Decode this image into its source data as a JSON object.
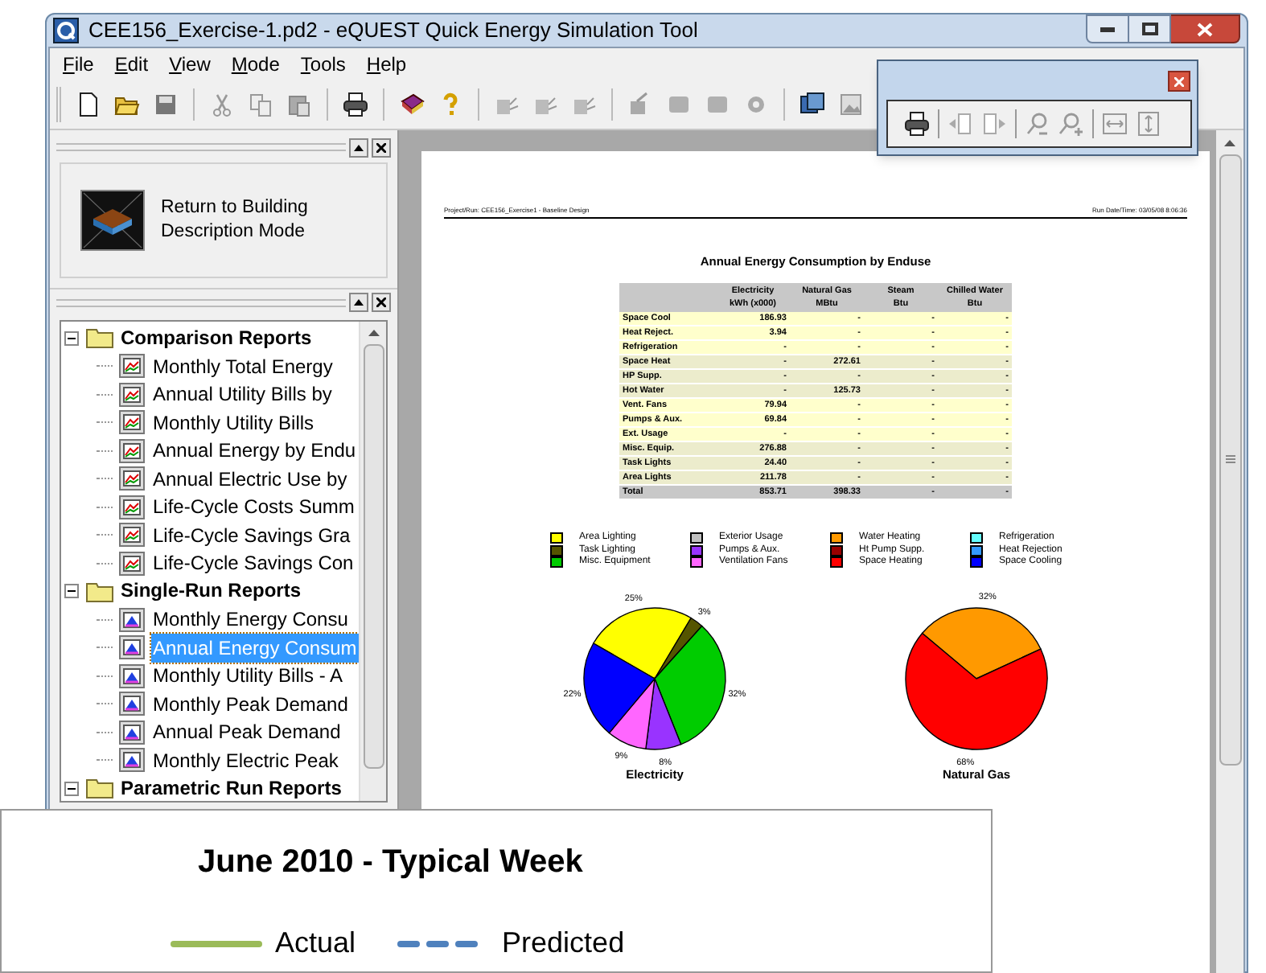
{
  "window": {
    "title": "CEE156_Exercise-1.pd2 - eQUEST Quick Energy Simulation Tool"
  },
  "menu": [
    "File",
    "Edit",
    "View",
    "Mode",
    "Tools",
    "Help"
  ],
  "mode_button": {
    "label": "Return to Building Description Mode"
  },
  "report_tree": [
    {
      "label": "Comparison Reports",
      "expanded": true,
      "children": [
        {
          "label": "Monthly Total Energy",
          "selected": false
        },
        {
          "label": "Annual Utility Bills by",
          "selected": false
        },
        {
          "label": "Monthly Utility Bills",
          "selected": false
        },
        {
          "label": "Annual Energy by Endu",
          "selected": false
        },
        {
          "label": "Annual Electric Use by",
          "selected": false
        },
        {
          "label": "Life-Cycle Costs Summ",
          "selected": false
        },
        {
          "label": "Life-Cycle Savings Gra",
          "selected": false
        },
        {
          "label": "Life-Cycle Savings Con",
          "selected": false
        }
      ]
    },
    {
      "label": "Single-Run Reports",
      "expanded": true,
      "children": [
        {
          "label": "Monthly Energy Consu",
          "selected": false
        },
        {
          "label": "Annual Energy Consum",
          "selected": true
        },
        {
          "label": "Monthly Utility Bills - A",
          "selected": false
        },
        {
          "label": "Monthly Peak Demand",
          "selected": false
        },
        {
          "label": "Annual Peak Demand",
          "selected": false
        },
        {
          "label": "Monthly Electric Peak",
          "selected": false
        }
      ]
    },
    {
      "label": "Parametric Run Reports",
      "expanded": true
    }
  ],
  "report": {
    "header_left": "Project/Run: CEE156_Exercise1 - Baseline Design",
    "header_right": "Run Date/Time: 03/05/08 8:06:36",
    "title": "Annual Energy Consumption by Enduse",
    "table": {
      "columns": [
        {
          "name": "Electricity",
          "unit": "kWh (x000)"
        },
        {
          "name": "Natural Gas",
          "unit": "MBtu"
        },
        {
          "name": "Steam",
          "unit": "Btu"
        },
        {
          "name": "Chilled Water",
          "unit": "Btu"
        }
      ],
      "rows": [
        {
          "kind": "data",
          "label": "Space Cool",
          "cells": [
            "186.93",
            "-",
            "-",
            "-"
          ]
        },
        {
          "kind": "data",
          "label": "Heat Reject.",
          "cells": [
            "3.94",
            "-",
            "-",
            "-"
          ]
        },
        {
          "kind": "data",
          "label": "Refrigeration",
          "cells": [
            "-",
            "-",
            "-",
            "-"
          ]
        },
        {
          "kind": "data",
          "label": "Space Heat",
          "cells": [
            "-",
            "272.61",
            "-",
            "-"
          ]
        },
        {
          "kind": "data",
          "label": "HP Supp.",
          "cells": [
            "-",
            "-",
            "-",
            "-"
          ]
        },
        {
          "kind": "data",
          "label": "Hot Water",
          "cells": [
            "-",
            "125.73",
            "-",
            "-"
          ]
        },
        {
          "kind": "data",
          "label": "Vent. Fans",
          "cells": [
            "79.94",
            "-",
            "-",
            "-"
          ]
        },
        {
          "kind": "data",
          "label": "Pumps & Aux.",
          "cells": [
            "69.84",
            "-",
            "-",
            "-"
          ]
        },
        {
          "kind": "data",
          "label": "Ext. Usage",
          "cells": [
            "-",
            "-",
            "-",
            "-"
          ]
        },
        {
          "kind": "data",
          "label": "Misc. Equip.",
          "cells": [
            "276.88",
            "-",
            "-",
            "-"
          ]
        },
        {
          "kind": "data",
          "label": "Task Lights",
          "cells": [
            "24.40",
            "-",
            "-",
            "-"
          ]
        },
        {
          "kind": "data",
          "label": "Area Lights",
          "cells": [
            "211.78",
            "-",
            "-",
            "-"
          ]
        },
        {
          "kind": "total",
          "label": "Total",
          "cells": [
            "853.71",
            "398.33",
            "-",
            "-"
          ]
        }
      ]
    },
    "legend": [
      {
        "label": "Area Lighting",
        "color": "#ffff00"
      },
      {
        "label": "Task Lighting",
        "color": "#555500"
      },
      {
        "label": "Misc. Equipment",
        "color": "#00cc00"
      },
      {
        "label": "Exterior Usage",
        "color": "#c0c0c0"
      },
      {
        "label": "Pumps & Aux.",
        "color": "#9933ff"
      },
      {
        "label": "Ventilation Fans",
        "color": "#ff66ff"
      },
      {
        "label": "Water Heating",
        "color": "#ff9900"
      },
      {
        "label": "Ht Pump Supp.",
        "color": "#990000"
      },
      {
        "label": "Space Heating",
        "color": "#ff0000"
      },
      {
        "label": "Refrigeration",
        "color": "#66ffff"
      },
      {
        "label": "Heat Rejection",
        "color": "#3399ff"
      },
      {
        "label": "Space Cooling",
        "color": "#0000ff"
      }
    ],
    "charts": [
      {
        "chart_data": {
          "type": "pie",
          "title": "Electricity",
          "values": [
            25,
            3,
            32,
            8,
            9,
            22
          ],
          "colors": [
            "#ffff00",
            "#555500",
            "#00cc00",
            "#9933ff",
            "#ff66ff",
            "#0000ff"
          ],
          "value_labels": [
            "25%",
            "3%",
            "32%",
            "8%",
            "9%",
            "22%"
          ]
        }
      },
      {
        "chart_data": {
          "type": "pie",
          "title": "Natural Gas",
          "values": [
            32,
            68
          ],
          "colors": [
            "#ff9900",
            "#ff0000"
          ],
          "value_labels": [
            "32%",
            "68%"
          ]
        }
      }
    ]
  },
  "overlay_chart": {
    "title": "June 2010 - Typical Week",
    "legend": [
      {
        "label": "Actual",
        "color": "#9bbb59",
        "kind": "solid"
      },
      {
        "label": "Predicted",
        "color": "#4f81bd",
        "kind": "dashed"
      }
    ]
  }
}
